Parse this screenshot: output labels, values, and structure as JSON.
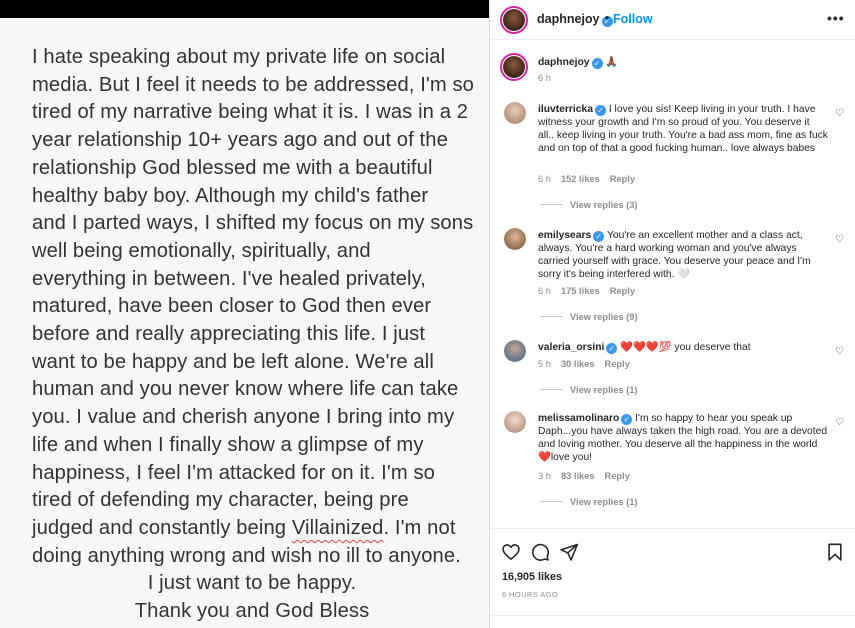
{
  "post": {
    "lines": [
      "I hate speaking about my private life on social",
      "media. But I feel it needs to be addressed, I'm so",
      "tired of my narrative being what it is. I was in a 2",
      "year relationship 10+ years ago and out of the",
      "relationship God blessed me with a beautiful",
      "healthy baby boy. Although my child's father",
      "and I parted ways, I shifted my focus on my sons",
      "well being emotionally, spiritually, and",
      "everything in between. I've healed privately,",
      "matured, have been closer to God then ever",
      "before and really appreciating this life. I just",
      "want to be happy and be left alone. We're all",
      "human and you never know where life can take",
      "you. I value and cherish anyone I bring into my",
      "life and when I finally show a glimpse of my",
      "happiness, I feel I'm attacked for on it. I'm so",
      "tired of defending my character, being pre"
    ],
    "line18_pre": "judged and constantly being ",
    "line18_word": "Villainized",
    "line18_post": ". I'm not",
    "line19": "doing anything wrong and wish no ill to anyone.",
    "closing1": "I just want to be happy.",
    "closing2": "Thank you and God Bless"
  },
  "header": {
    "username": "daphnejoy",
    "dot": "•",
    "follow": "Follow",
    "more": "•••"
  },
  "caption": {
    "username": "daphnejoy",
    "emoji": "🙏🏾",
    "time": "6 h"
  },
  "comments": [
    {
      "username": "iluvterricka",
      "text": "I love you sis! Keep living in your truth. I have witness your growth and I'm so proud of you. You deserve it all.. keep living in your truth. You're a bad ass mom, fine as fuck and on top of that a good fucking human.. love always babes",
      "time": "6 h",
      "likes": "152 likes",
      "reply": "Reply",
      "replies": "View replies (3)",
      "avatar_color": "#c9a58c"
    },
    {
      "username": "emilysears",
      "text": "You're an excellent mother and a class act, always. You're a hard working woman and you've always carried yourself with grace. You deserve your peace and I'm sorry it's being interfered with. 🤍",
      "time": "6 h",
      "likes": "175 likes",
      "reply": "Reply",
      "replies": "View replies (9)",
      "avatar_color": "#b58a68"
    },
    {
      "username": "valeria_orsini",
      "text": "❤️❤️❤️💯 you deserve that",
      "time": "5 h",
      "likes": "30 likes",
      "reply": "Reply",
      "replies": "View replies (1)",
      "avatar_color": "#7a8fa8"
    },
    {
      "username": "melissamolinaro",
      "text": "I'm so happy to hear you speak up Daph...you have always taken the high road. You are a devoted and loving mother. You deserve all the happiness in the world❤️love you!",
      "time": "3 h",
      "likes": "83 likes",
      "reply": "Reply",
      "replies": "View replies (1)",
      "avatar_color": "#d8b8a0"
    }
  ],
  "footer": {
    "likes": "16,905 likes",
    "time": "6 HOURS AGO"
  },
  "colors": {
    "accent": "#0095f6",
    "verified": "#3897f0",
    "muted": "#8e8e8e"
  },
  "icons": [
    "heart-icon",
    "comment-icon",
    "share-icon",
    "bookmark-icon",
    "more-icon",
    "verified-icon"
  ]
}
